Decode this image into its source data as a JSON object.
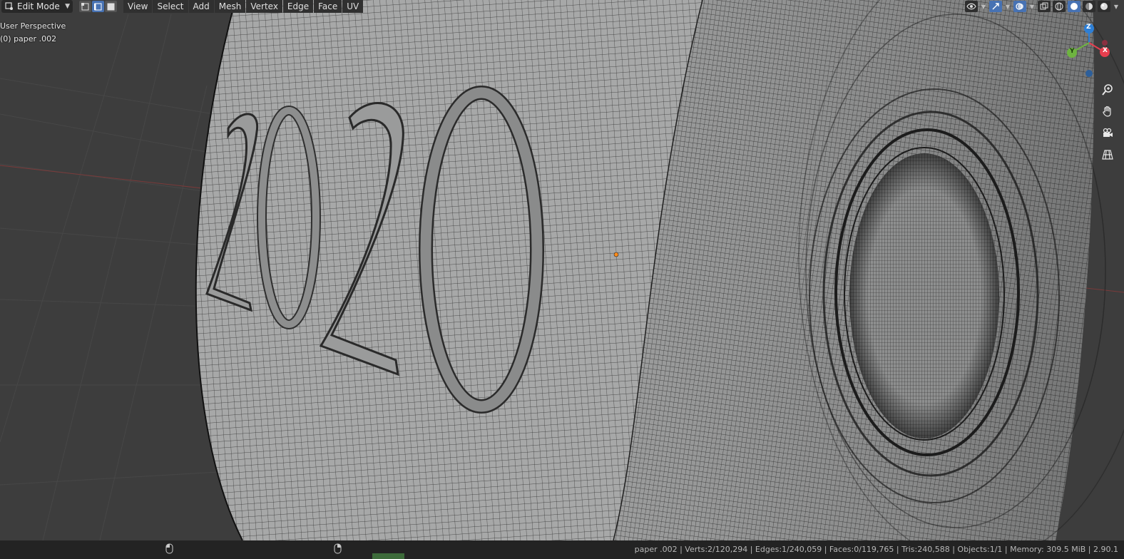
{
  "header": {
    "mode_label": "Edit Mode",
    "menus": [
      "View",
      "Select",
      "Add",
      "Mesh",
      "Vertex",
      "Edge",
      "Face",
      "UV"
    ],
    "select_modes": [
      {
        "name": "vertex-select",
        "active": false
      },
      {
        "name": "edge-select",
        "active": true
      },
      {
        "name": "face-select",
        "active": false
      }
    ]
  },
  "viewport": {
    "view_name": "User Perspective",
    "object_info": "(0) paper .002",
    "gizmo_axes": {
      "x": "X",
      "y": "Y",
      "z": "Z"
    },
    "model_text": "2020"
  },
  "status": {
    "stats": "paper .002 | Verts:2/120,294 | Edges:1/240,059 | Faces:0/119,765 | Tris:240,588 | Objects:1/1 | Memory: 309.5 MiB | 2.90.1"
  },
  "colors": {
    "accent": "#4772b3",
    "axis_x": "#e63e4e",
    "axis_y": "#6eb440",
    "axis_z": "#2d7fd6",
    "mesh_surface": "#a9a9a9",
    "grid_bg": "#3d3d3d"
  }
}
